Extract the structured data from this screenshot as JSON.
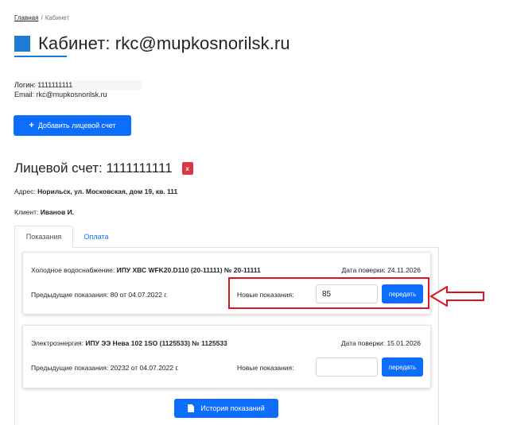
{
  "breadcrumb": {
    "home": "Главная",
    "separator": "/",
    "current": "Кабинет"
  },
  "page": {
    "title": "Кабинет: rkc@mupkosnorilsk.ru",
    "accent_color": "#1f7ad1"
  },
  "user": {
    "login_label": "Логин:",
    "login_value": "1111111111",
    "email_label": "Email:",
    "email_value": "rkc@mupkosnorilsk.ru"
  },
  "actions": {
    "add_account_icon": "plus-icon",
    "add_account_label": "Добавить лицевой счет",
    "history_icon": "document-icon",
    "history_label": "История показаний"
  },
  "account": {
    "title": "Лицевой счет: 1111111111",
    "delete_label": "x",
    "address_label": "Адрес:",
    "address_value": "Норильск, ул. Московская, дом 19, кв. 111",
    "client_label": "Клиент:",
    "client_value": "Иванов И."
  },
  "tabs": [
    {
      "label": "Показания",
      "active": true
    },
    {
      "label": "Оплата",
      "active": false
    }
  ],
  "meters": [
    {
      "service": "Холодное водоснабжение:",
      "device": "ИПУ ХВС WFK20.D110 (20-11111)  № 20-11111",
      "verify_label": "Дата поверки:",
      "verify_date": "24.11.2026",
      "prev_label": "Предыдущие показания:",
      "prev_value": "80 от 04.07.2022 г.",
      "new_label": "Новые показания:",
      "new_value": "85",
      "send_label": "передать"
    },
    {
      "service": "Электроэнергия:",
      "device": "ИПУ ЭЭ Нева 102 1SO (1125533)  № 1125533",
      "verify_label": "Дата поверки:",
      "verify_date": "15.01.2026",
      "prev_label": "Предыдущие показания:",
      "prev_value": "20232 от 04.07.2022 г.",
      "new_label": "Новые показания:",
      "new_value": "",
      "send_label": "передать"
    }
  ],
  "colors": {
    "primary": "#0d6efd",
    "danger": "#dc3545",
    "annotation": "#e0141e"
  }
}
